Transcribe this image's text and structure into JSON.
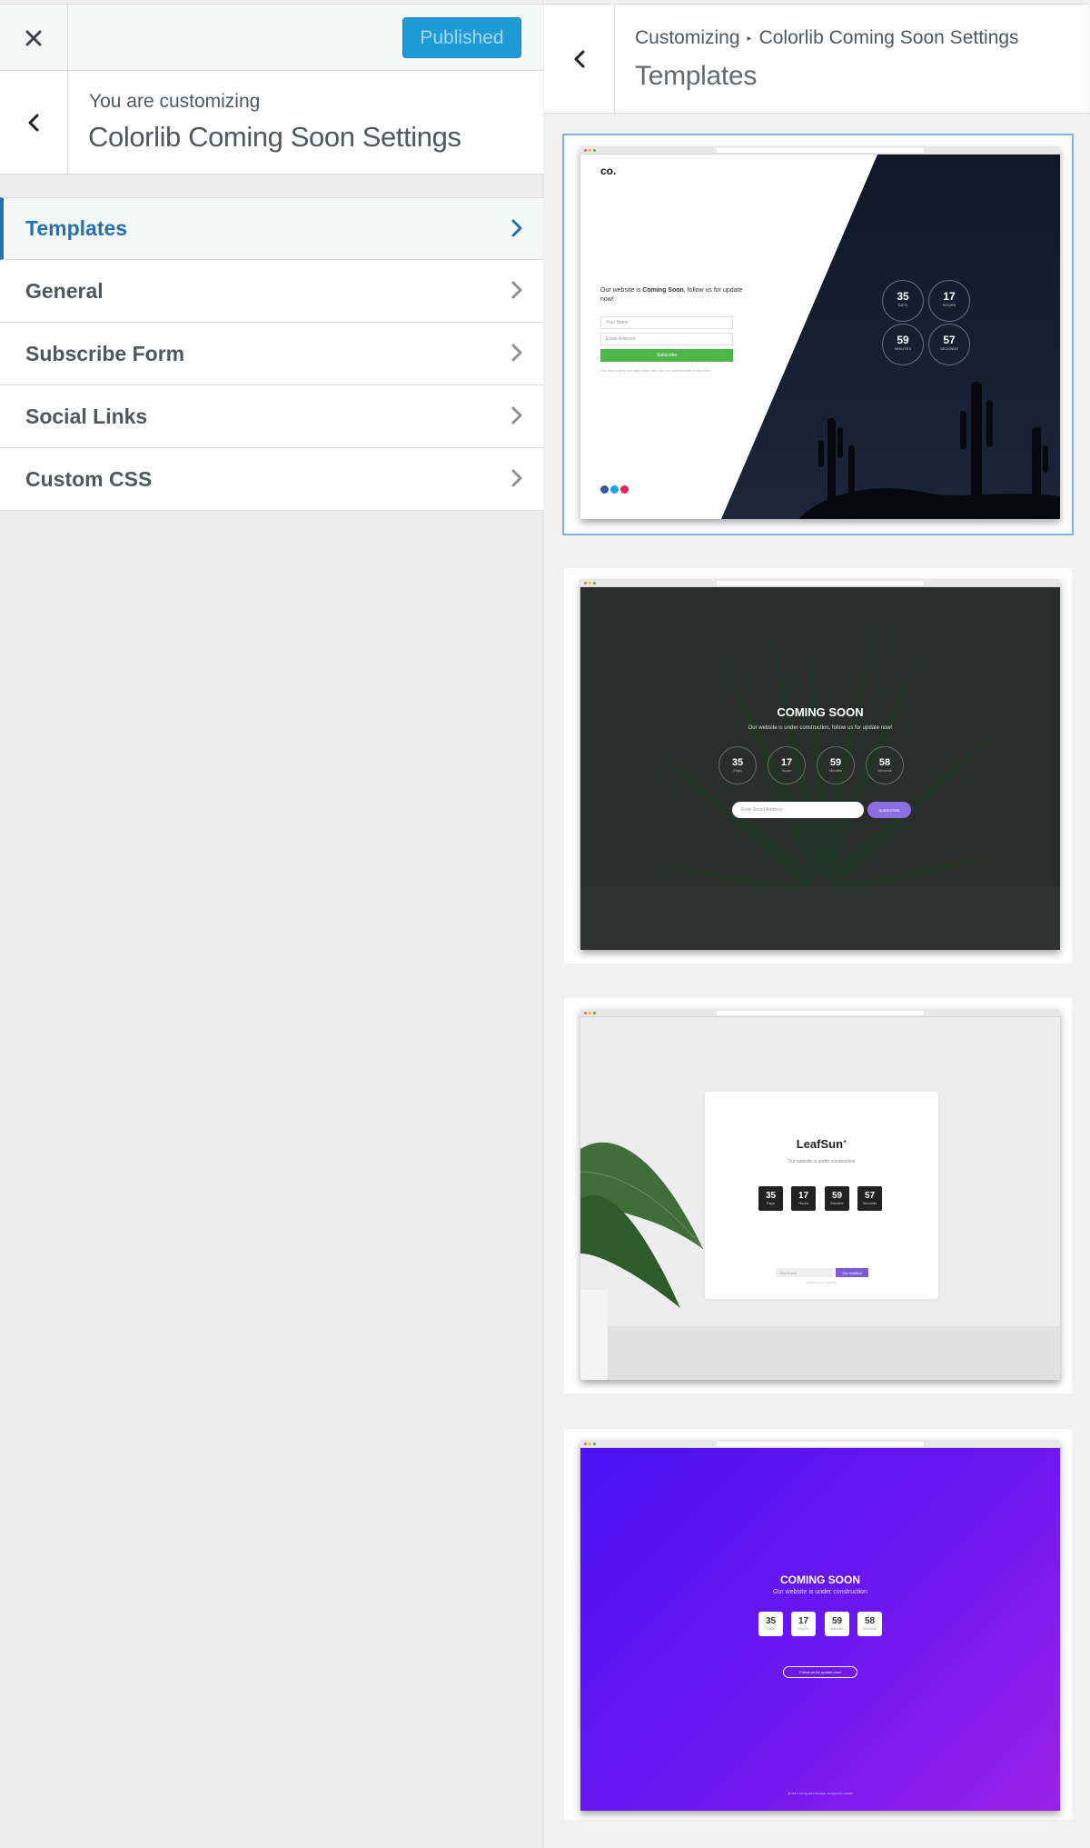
{
  "topbar": {
    "close_label": "×",
    "publish_label": "Published"
  },
  "info": {
    "subtitle": "You are customizing",
    "title": "Colorlib Coming Soon Settings"
  },
  "nav": {
    "items": [
      {
        "label": "Templates",
        "active": true
      },
      {
        "label": "General"
      },
      {
        "label": "Subscribe Form"
      },
      {
        "label": "Social Links"
      },
      {
        "label": "Custom CSS"
      }
    ]
  },
  "panel": {
    "breadcrumb_root": "Customizing",
    "breadcrumb_section": "Colorlib Coming Soon Settings",
    "title": "Templates"
  },
  "templates": [
    {
      "logo": "co.",
      "tagline_pre": "Our website is ",
      "tagline_bold": "Coming Soon",
      "tagline_post": ", follow us for update now!",
      "name_placeholder": "Your Name",
      "email_placeholder": "Email Address",
      "button": "Subscribe",
      "fineprint": "And don't worry, we hate spam too! You can unsubscribe at any time.",
      "countdown": [
        {
          "value": "35",
          "unit": "DAYS"
        },
        {
          "value": "17",
          "unit": "HOURS"
        },
        {
          "value": "59",
          "unit": "MINUTES"
        },
        {
          "value": "57",
          "unit": "SECONDS"
        }
      ]
    },
    {
      "heading": "COMING SOON",
      "subheading": "Our website is under construction, follow us for update now!",
      "email_placeholder": "Enter Email Address",
      "button": "SUBSCRIBE",
      "countdown": [
        {
          "value": "35",
          "unit": "Days"
        },
        {
          "value": "17",
          "unit": "Hours"
        },
        {
          "value": "59",
          "unit": "Minutes"
        },
        {
          "value": "58",
          "unit": "Seconds"
        }
      ]
    },
    {
      "brand": "LeafSun",
      "subheading": "Our website is under construction",
      "email_placeholder": "Your Email",
      "button": "Get Notified",
      "fineprint": "Contact us at: email here",
      "countdown": [
        {
          "value": "35",
          "unit": "Days"
        },
        {
          "value": "17",
          "unit": "Hours"
        },
        {
          "value": "59",
          "unit": "Minutes"
        },
        {
          "value": "57",
          "unit": "Seconds"
        }
      ]
    },
    {
      "heading": "COMING SOON",
      "subheading": "Our website is under construction",
      "button": "Follow us for update now!",
      "footer": "@ 2017 Coming soon Template. Designed by Colorlib",
      "countdown": [
        {
          "value": "35",
          "unit": "Days"
        },
        {
          "value": "17",
          "unit": "Hours"
        },
        {
          "value": "59",
          "unit": "Minutes"
        },
        {
          "value": "58",
          "unit": "Seconds"
        }
      ]
    }
  ],
  "colors": {
    "accent": "#2271b1",
    "publish": "#1e9bd6",
    "green": "#4cb648",
    "purple": "#5a17f0"
  }
}
